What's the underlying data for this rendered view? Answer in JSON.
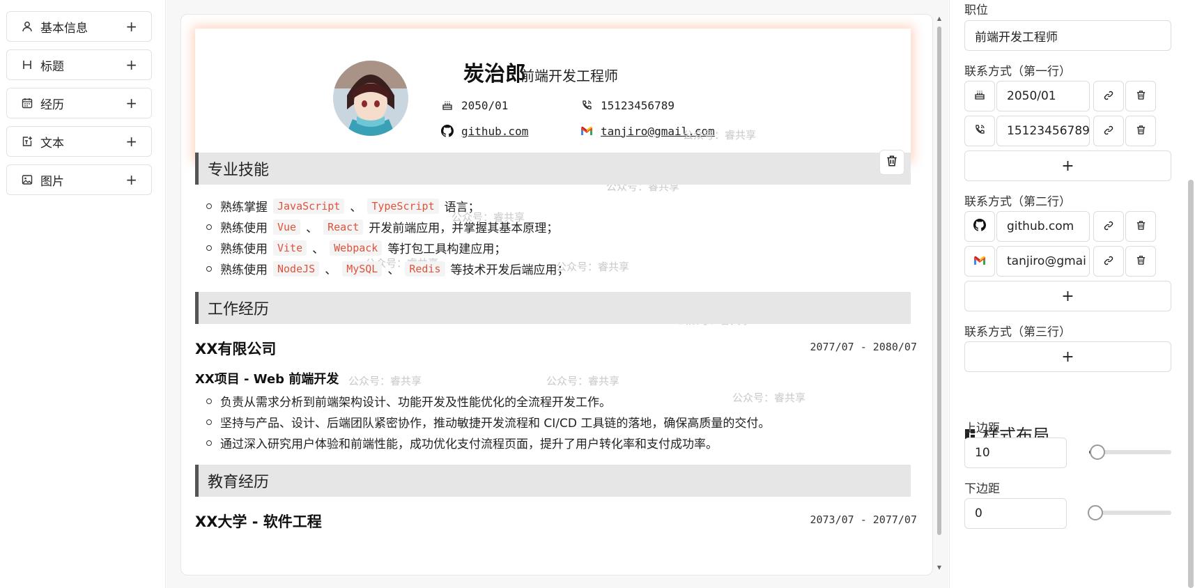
{
  "sidebar": {
    "items": [
      {
        "label": "基本信息",
        "icon": "user-icon"
      },
      {
        "label": "标题",
        "icon": "heading-icon"
      },
      {
        "label": "经历",
        "icon": "calendar-icon"
      },
      {
        "label": "文本",
        "icon": "text-add-icon"
      },
      {
        "label": "图片",
        "icon": "image-icon"
      }
    ],
    "add": "+"
  },
  "resume": {
    "name": "炭治郎",
    "role": "前端开发工程师",
    "contacts": [
      {
        "icon": "cake-icon",
        "text": "2050/01"
      },
      {
        "icon": "phone-icon",
        "text": "15123456789"
      },
      {
        "icon": "github-icon",
        "text": "github.com"
      },
      {
        "icon": "gmail-icon",
        "text": "tanjiro@gmail.com"
      }
    ],
    "watermark": "公众号：睿共享",
    "sections": {
      "skills": "专业技能",
      "work": "工作经历",
      "education": "教育经历"
    },
    "skills": [
      {
        "pre": "熟练掌握",
        "codes": [
          "JavaScript",
          "TypeScript"
        ],
        "seps": [
          "、"
        ],
        "post": "语言；"
      },
      {
        "pre": "熟练使用",
        "codes": [
          "Vue",
          "React"
        ],
        "seps": [
          "、"
        ],
        "post": "开发前端应用，并掌握其基本原理；"
      },
      {
        "pre": "熟练使用",
        "codes": [
          "Vite",
          "Webpack"
        ],
        "seps": [
          "、"
        ],
        "post": "等打包工具构建应用；"
      },
      {
        "pre": "熟练使用",
        "codes": [
          "NodeJS",
          "MySQL",
          "Redis"
        ],
        "seps": [
          "、",
          "、"
        ],
        "post": "等技术开发后端应用；"
      }
    ],
    "work": {
      "company": "XX有限公司",
      "date": "2077/07 - 2080/07",
      "project": "XX项目 - Web 前端开发",
      "bullets": [
        "负责从需求分析到前端架构设计、功能开发及性能优化的全流程开发工作。",
        "坚持与产品、设计、后端团队紧密协作，推动敏捷开发流程和 CI/CD 工具链的落地，确保高质量的交付。",
        "通过深入研究用户体验和前端性能，成功优化支付流程页面，提升了用户转化率和支付成功率。"
      ]
    },
    "education": {
      "school": "XX大学 - 软件工程",
      "date": "2073/07 - 2077/07"
    }
  },
  "panel": {
    "position_label": "职位",
    "position_value": "前端开发工程师",
    "row1_label": "联系方式（第一行）",
    "row1": [
      {
        "icon": "cake-icon",
        "value": "2050/01"
      },
      {
        "icon": "phone-icon",
        "value": "15123456789"
      }
    ],
    "row2_label": "联系方式（第二行）",
    "row2": [
      {
        "icon": "github-icon",
        "value": "github.com"
      },
      {
        "icon": "gmail-icon",
        "value": "tanjiro@gmai"
      }
    ],
    "row3_label": "联系方式（第三行）",
    "add": "+",
    "style_title": "样式布局",
    "top_margin_label": "上边距",
    "top_margin_value": "10",
    "top_margin_fraction": 0.1,
    "bottom_margin_label": "下边距",
    "bottom_margin_value": "0",
    "bottom_margin_fraction": 0.0
  }
}
